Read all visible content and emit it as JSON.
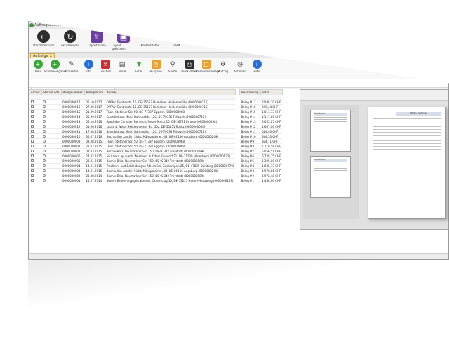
{
  "window": {
    "title": "Auftragsbearbeitung (1) Offene - Aufträge"
  },
  "ribbon1": [
    {
      "label": "Startbildschirm",
      "icon": "back-arrow-icon"
    },
    {
      "label": "Aktualisieren",
      "icon": "refresh-icon"
    },
    {
      "label": "Layout laden",
      "icon": "upload-icon"
    },
    {
      "label": "Layout speichern",
      "icon": "save-icon"
    },
    {
      "label": "Kontaktdaten",
      "icon": "phone-icon"
    },
    {
      "label": "CRM",
      "icon": "people-icon"
    },
    {
      "label": "Erinnerungen",
      "icon": "alarm-icon"
    },
    {
      "label": "Neue Aufgabe",
      "icon": "tools-icon"
    }
  ],
  "tab": {
    "label": "Aufträge"
  },
  "ribbon2": [
    {
      "label": "Neu",
      "icon": "plus-icon"
    },
    {
      "label": "Schnelleingabe",
      "icon": "plus-icon"
    },
    {
      "label": "Korrektur",
      "icon": "pencil-icon"
    },
    {
      "label": "Info",
      "icon": "info-icon"
    },
    {
      "label": "Löschen",
      "icon": "delete-icon"
    },
    {
      "label": "Texte",
      "icon": "document-icon"
    },
    {
      "label": "Filter",
      "icon": "filter-icon"
    },
    {
      "label": "Ausgabe",
      "icon": "print-icon"
    },
    {
      "label": "Suche",
      "icon": "search-icon"
    },
    {
      "label": "Direktdruck",
      "icon": "printer-icon"
    },
    {
      "label": "Dokumentenablage",
      "icon": "folder-icon"
    },
    {
      "label": "Auftrag",
      "icon": "order-icon"
    },
    {
      "label": "Aktionen",
      "icon": "clock-icon"
    },
    {
      "label": "Hilfe",
      "icon": "help-icon"
    }
  ],
  "search": {
    "placeholder": "Suche"
  },
  "table": {
    "columns": [
      "Archiv",
      "StatusCode",
      "Belegnummer",
      "Belegdatum",
      "Anrede"
    ],
    "rows": [
      {
        "nr": "0000000017",
        "date": "06.10.2017",
        "name": "OPPAV, Bundesstr. 15, DE-35557 Hamelner Heidemenühe (0000000716)"
      },
      {
        "nr": "0000000016",
        "date": "27.09.2017",
        "name": "OPPAV, Bundesstr. 15, DE-35557 Hamelner Heidemenühe (0000000716)"
      },
      {
        "nr": "0000000015",
        "date": "21.09.2017",
        "name": "Thon, Stettiner Str. 50, DE-77387 Eggenn (0000000068)"
      },
      {
        "nr": "0000000014",
        "date": "05.09.2017",
        "name": "Sanitätshaus Mark, Bahnhofstr. 120, DE-70736 Fellbach (0000000716)"
      },
      {
        "nr": "0000000013",
        "date": "06.10.2016",
        "name": "Apotheke Christian Behnsch, Neuer Markt 15, DE-26721 Emden (0000000498)"
      },
      {
        "nr": "0000000012",
        "date": "01.06.2016",
        "name": "Locke & Weiss, Heidesheimer Str. 55a, DE-55131 Mainz (0000000068)"
      },
      {
        "nr": "0000000011",
        "date": "17.08.2016",
        "name": "Sanitätshaus Mark, Bahnhofstr. 120, DE-70736 Fellbach (0000000716)"
      },
      {
        "nr": "0000000010",
        "date": "30.07.2016",
        "name": "Buchhallen Land in Sicht, Mäingaßeiner, 43, DE-86156 Augsburg (0000000249)"
      },
      {
        "nr": "0000000009",
        "date": "09.08.2015",
        "name": "Thon, Stettiner Str. 50, DE-77387 Eggenn (0000000068)"
      },
      {
        "nr": "0000000008",
        "date": "22.07.2015",
        "name": "Thon, Stettiner Str. 50, DE-77387 Eggenn (0000000068)"
      },
      {
        "nr": "0000000007",
        "date": "04.03.2015",
        "name": "Bücher-Blitz, Neumarkter Str. 150, DE-92342 Freystadt (0000000189)"
      },
      {
        "nr": "0000000006",
        "date": "27.02.2015",
        "name": "Sri Lanka Ayurveda Wellness, Auf dem Gundorf 21, DE-21129 Hildesheim (0000000772)"
      },
      {
        "nr": "0000000005",
        "date": "28.01.2015",
        "name": "Bücher-Blitz, Neumarkter Str. 150, DE-92342 Freystadt (0000000189)"
      },
      {
        "nr": "0000000004",
        "date": "14.01.2015",
        "name": "Trachten- und Bekleidungen Adlermühl, Seekampen 25, DE-47839 Duisburg (0000000779)"
      },
      {
        "nr": "0000000003",
        "date": "14.01.2015",
        "name": "Buchhallen Land in Sicht, Mäingaßeiner, 43, DE-86156 Augsburg (0000000249)"
      },
      {
        "nr": "0000000002",
        "date": "28.08.2014",
        "name": "Bücher-Blitz, Neumarkter Str. 150, DE-92342 Freystadt (0000000189)"
      },
      {
        "nr": "0000000001",
        "date": "14.07.2014",
        "name": "Broer's Brüderungsgestaltende, Ostenstrag 10, DE-53227 Hamm-Heitzberg (0000000249)"
      }
    ]
  },
  "mid_table": {
    "columns": [
      "Bearbeitung",
      "Total"
    ],
    "values": [
      "Beleg #17",
      "Beleg #16",
      "Beleg #15",
      "Beleg #14",
      "Beleg #13",
      "Beleg #12",
      "Beleg #11",
      "Beleg #10",
      "Beleg #9",
      "Beleg #8",
      "Beleg #7",
      "Beleg #6",
      "Beleg #5",
      "Beleg #4",
      "Beleg #3",
      "Beleg #2",
      "Beleg #1"
    ],
    "totals": [
      "2.088,10 CHF",
      "329,44 CHF",
      "1.011,73 CHF",
      "1.117,60 CHF",
      "5.055,25 CHF",
      "1.667,00 CHF",
      "544,40 CHF",
      "304,10 CHF",
      "864,71 CHF",
      "1.118,58 CHF",
      "5.056,51 CHF",
      "6.728,75 CHF",
      "1.395,00 CHF",
      "1.685,73 CHF",
      "1.978,66 CHF",
      "6.972,48 CHF",
      "1.448,00 CHF"
    ]
  },
  "preview": {
    "page_title": "Offene Aufträge",
    "thumb_titles": [
      "Offene Aufträge",
      "Offene Aufträge",
      "Offene Aufträge"
    ]
  }
}
